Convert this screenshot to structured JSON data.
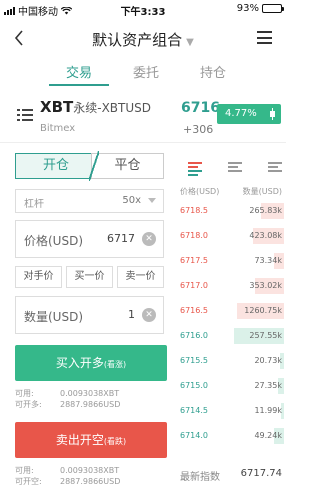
{
  "status_bar": {
    "carrier": "中国移动",
    "time": "下午3:33",
    "battery": "93%"
  },
  "nav": {
    "title": "默认资产组合",
    "back_icon": "chevron-left-icon",
    "menu_icon": "hamburger-icon"
  },
  "tabs": [
    {
      "label": "交易",
      "active": true
    },
    {
      "label": "委托",
      "active": false
    },
    {
      "label": "持仓",
      "active": false
    }
  ],
  "instrument": {
    "symbol": "XBT",
    "suffix": "永续-XBTUSD",
    "exchange": "Bitmex",
    "price": "6716",
    "change": "+306",
    "change_pct": "4.77%"
  },
  "order_form": {
    "open_label": "开仓",
    "close_label": "平仓",
    "leverage_label": "杠杆",
    "leverage_value": "50x",
    "price_label": "价格(USD)",
    "price_value": "6717",
    "quick_buttons": [
      "对手价",
      "买一价",
      "卖一价"
    ],
    "qty_label": "数量(USD)",
    "qty_value": "1",
    "buy_label": "买入开多",
    "buy_sub": "(看涨)",
    "buy_info": [
      {
        "k": "可用:",
        "v": "0.0093038XBT"
      },
      {
        "k": "可开多:",
        "v": "2887.9866USD"
      }
    ],
    "sell_label": "卖出开空",
    "sell_sub": "(看跌)",
    "sell_info": [
      {
        "k": "可用:",
        "v": "0.0093038XBT"
      },
      {
        "k": "可开空:",
        "v": "2887.9866USD"
      }
    ]
  },
  "order_book": {
    "price_header": "价格(USD)",
    "qty_header": "数量(USD)",
    "asks": [
      {
        "price": "6718.5",
        "qty": "265.83k",
        "depth": 0.22
      },
      {
        "price": "6718.0",
        "qty": "423.08k",
        "depth": 0.3
      },
      {
        "price": "6717.5",
        "qty": "73.34k",
        "depth": 0.1
      },
      {
        "price": "6717.0",
        "qty": "353.02k",
        "depth": 0.28
      },
      {
        "price": "6716.5",
        "qty": "1260.75k",
        "depth": 0.45
      }
    ],
    "bids": [
      {
        "price": "6716.0",
        "qty": "257.55k",
        "depth": 0.48
      },
      {
        "price": "6715.5",
        "qty": "20.73k",
        "depth": 0.04
      },
      {
        "price": "6715.0",
        "qty": "27.35k",
        "depth": 0.06
      },
      {
        "price": "6714.5",
        "qty": "11.99k",
        "depth": 0.03
      },
      {
        "price": "6714.0",
        "qty": "49.24k",
        "depth": 0.1
      }
    ],
    "index_label": "最新指数",
    "index_value": "6717.74"
  }
}
